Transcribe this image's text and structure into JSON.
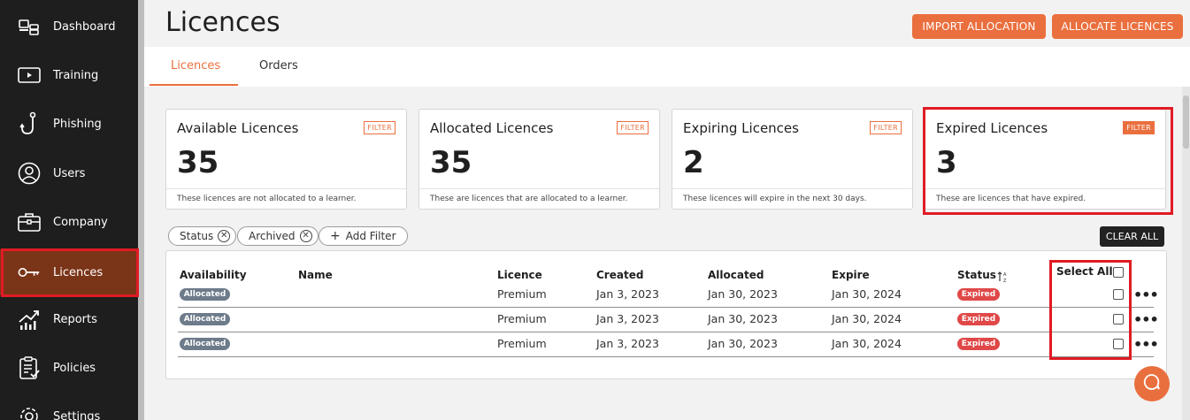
{
  "sidebar": {
    "items": [
      {
        "label": "Dashboard",
        "icon": "dashboard-icon"
      },
      {
        "label": "Training",
        "icon": "play-icon"
      },
      {
        "label": "Phishing",
        "icon": "hook-icon"
      },
      {
        "label": "Users",
        "icon": "user-icon"
      },
      {
        "label": "Company",
        "icon": "briefcase-icon"
      },
      {
        "label": "Licences",
        "icon": "key-icon",
        "active": true
      },
      {
        "label": "Reports",
        "icon": "chart-icon"
      },
      {
        "label": "Policies",
        "icon": "clipboard-icon"
      },
      {
        "label": "Settings",
        "icon": "gear-icon"
      }
    ]
  },
  "header": {
    "title": "Licences",
    "import_button": "IMPORT ALLOCATION",
    "allocate_button": "ALLOCATE LICENCES"
  },
  "tabs": [
    {
      "label": "Licences",
      "active": true
    },
    {
      "label": "Orders",
      "active": false
    }
  ],
  "cards": [
    {
      "title": "Available Licences",
      "filter": "FILTER",
      "value": "35",
      "description": "These licences are not allocated to a learner."
    },
    {
      "title": "Allocated Licences",
      "filter": "FILTER",
      "value": "35",
      "description": "These are licences that are allocated to a learner."
    },
    {
      "title": "Expiring Licences",
      "filter": "FILTER",
      "value": "2",
      "description": "These licences will expire in the next 30 days."
    },
    {
      "title": "Expired Licences",
      "filter": "FILTER",
      "value": "3",
      "description": "These are licences that have expired."
    }
  ],
  "filters": {
    "chips": [
      "Status",
      "Archived"
    ],
    "add_filter": "Add Filter",
    "clear_all": "CLEAR ALL"
  },
  "table": {
    "columns": [
      "Availability",
      "Name",
      "Licence",
      "Created",
      "Allocated",
      "Expire",
      "Status",
      "Select All"
    ],
    "rows": [
      {
        "availability": "Allocated",
        "name": "",
        "licence": "Premium",
        "created": "Jan 3, 2023",
        "allocated": "Jan 30, 2023",
        "expire": "Jan 30, 2024",
        "status": "Expired"
      },
      {
        "availability": "Allocated",
        "name": "",
        "licence": "Premium",
        "created": "Jan 3, 2023",
        "allocated": "Jan 30, 2023",
        "expire": "Jan 30, 2024",
        "status": "Expired"
      },
      {
        "availability": "Allocated",
        "name": "",
        "licence": "Premium",
        "created": "Jan 3, 2023",
        "allocated": "Jan 30, 2023",
        "expire": "Jan 30, 2024",
        "status": "Expired"
      }
    ]
  },
  "colors": {
    "accent": "#ea6f3e",
    "sidebar_bg": "#1e1e1e",
    "active_bg": "#7a3418",
    "highlight_outline": "#e01b24",
    "expired_badge": "#e04848",
    "allocated_badge": "#6d7b8a"
  }
}
